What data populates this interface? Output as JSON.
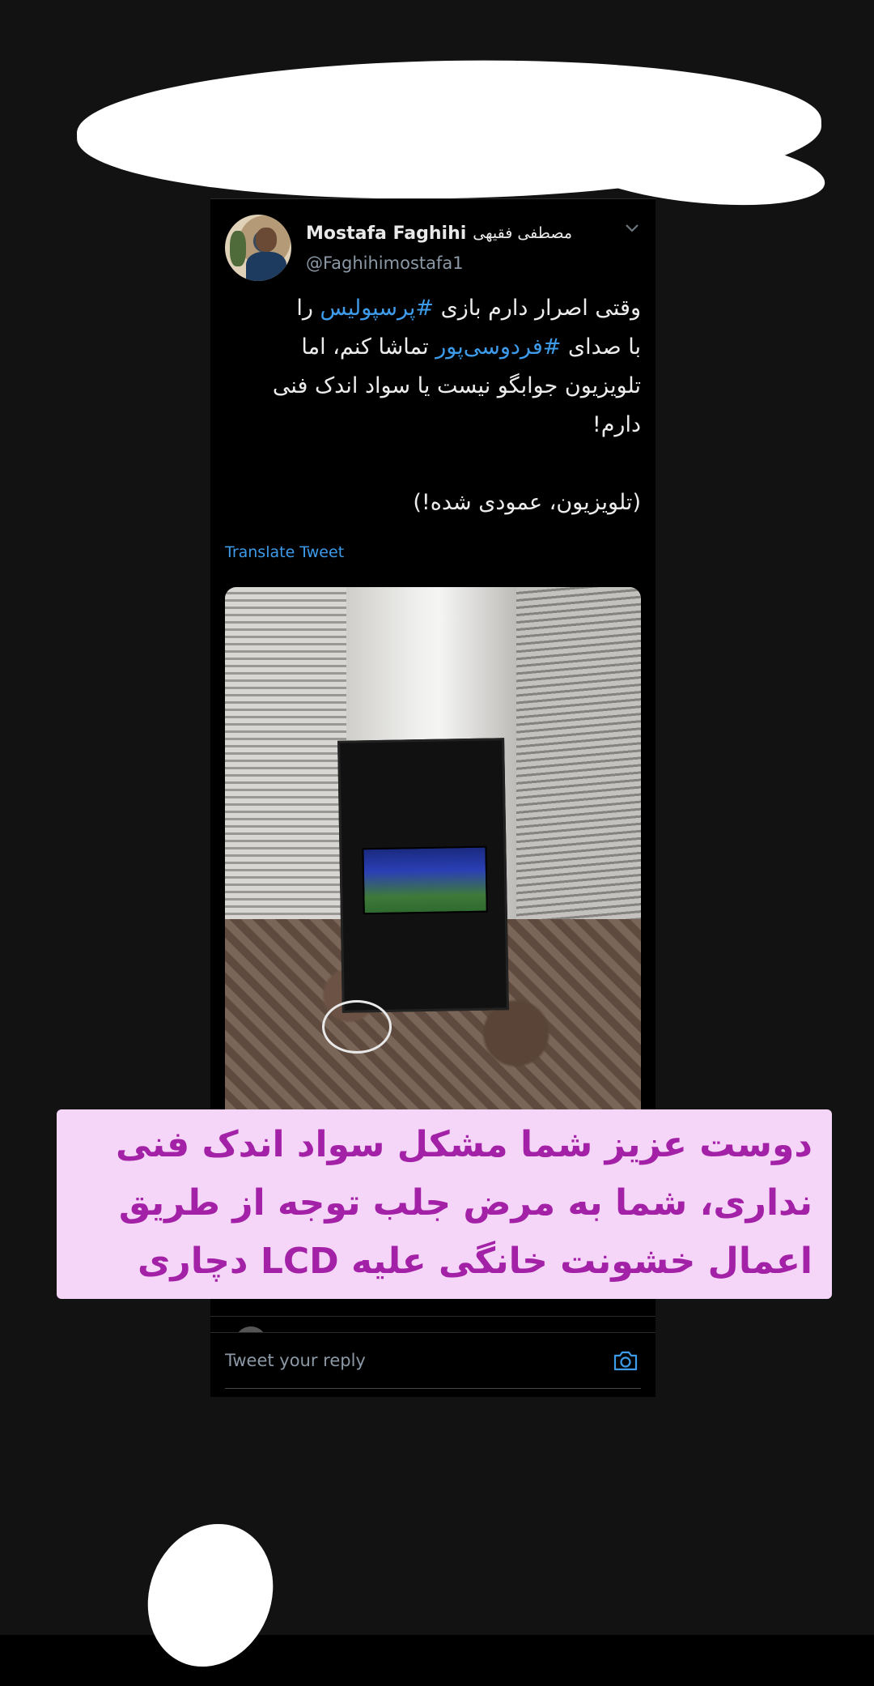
{
  "tweet": {
    "author": {
      "display_name": "Mostafa Faghihi",
      "display_name_fa": "مصطفی فقیهی",
      "handle": "@Faghihimostafa1"
    },
    "body_lines": [
      {
        "before": "وقتی اصرار دارم بازی ",
        "hashtag": "#پرسپولیس",
        "after": " را"
      },
      {
        "before": "با صدای ",
        "hashtag": "#فردوسی‌پور",
        "after": " تماشا کنم، اما"
      },
      {
        "before": "تلویزیون جوابگو نیست یا سواد اندک فنی",
        "hashtag": "",
        "after": ""
      },
      {
        "before": "دارم!",
        "hashtag": "",
        "after": ""
      },
      {
        "before": "(تلویزیون، عمودی شده!)",
        "hashtag": "",
        "after": ""
      }
    ],
    "translate_label": "Translate Tweet"
  },
  "caption": {
    "lines": [
      "دوست عزیز شما مشکل سواد اندک فنی",
      "نداری، شما به مرض جلب توجه از طریق",
      "اعمال خشونت خانگی علیه LCD دچاری"
    ]
  },
  "reply": {
    "placeholder": "Tweet your reply"
  },
  "colors": {
    "link": "#3d9be9",
    "caption_bg": "#f6d6f8",
    "caption_text": "#a321a7"
  },
  "icons": {
    "more_options": "chevron-down-icon",
    "camera": "camera-icon"
  }
}
